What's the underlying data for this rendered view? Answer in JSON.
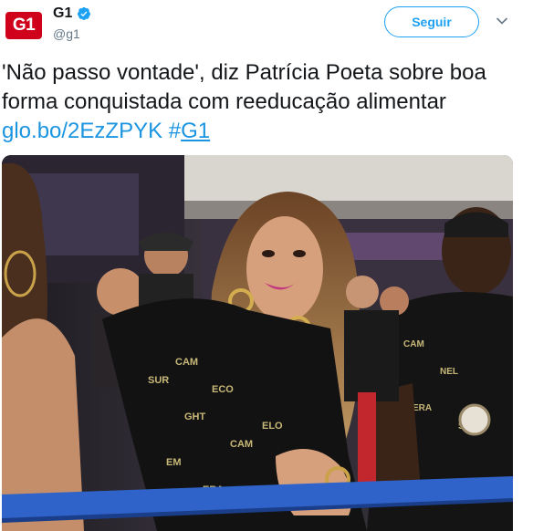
{
  "account": {
    "logo_text": "G1",
    "display_name": "G1",
    "handle": "@g1",
    "verified": true,
    "avatar_color": "#d0021b"
  },
  "actions": {
    "follow_label": "Seguir",
    "menu_icon": "chevron-down-icon"
  },
  "tweet": {
    "text": "'Não passo vontade', diz Patrícia Poeta sobre boa forma conquistada com reeducação alimentar",
    "link": "glo.bo/2EzZPYK",
    "hashtag_symbol": "#",
    "hashtag_tag": "G1"
  },
  "media": {
    "type": "photo"
  },
  "colors": {
    "accent": "#1da1f2",
    "link": "#1b95e0",
    "text": "#14171a",
    "muted": "#657786"
  }
}
